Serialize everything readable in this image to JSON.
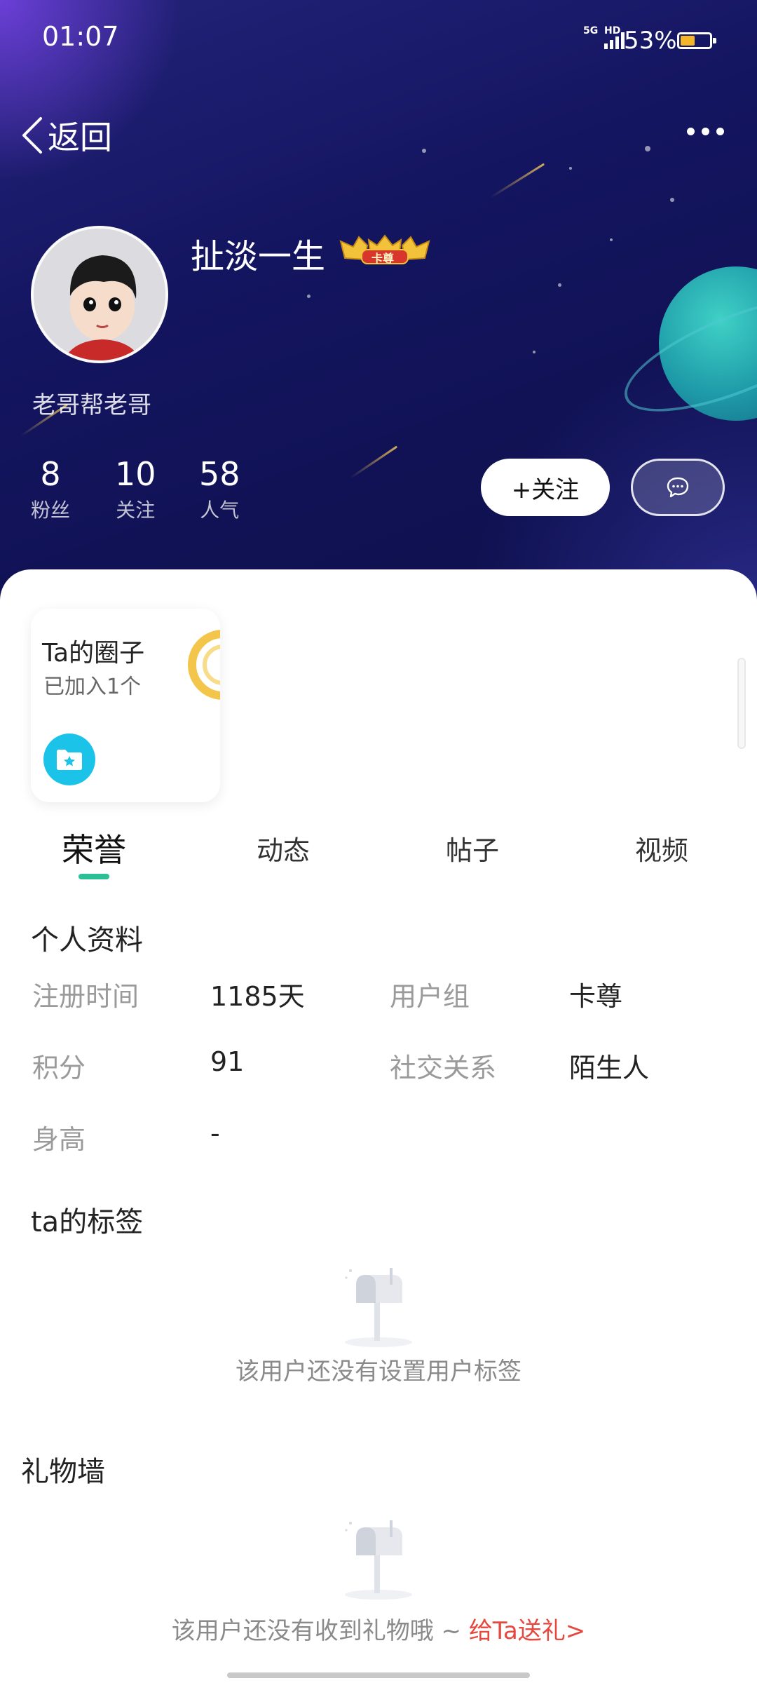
{
  "status_bar": {
    "time": "01:07",
    "network_top": "5G",
    "network_hd": "HD",
    "battery_percent": "53%",
    "battery_level": 0.53,
    "battery_color": "#f3b52a"
  },
  "nav": {
    "back_label": "返回"
  },
  "profile": {
    "username": "扯淡一生",
    "badge_text": "卡尊",
    "bio": "老哥帮老哥",
    "stats": [
      {
        "value": "8",
        "label": "粉丝"
      },
      {
        "value": "10",
        "label": "关注"
      },
      {
        "value": "58",
        "label": "人气"
      }
    ],
    "follow_label": "+关注"
  },
  "circle_card": {
    "title": "Ta的圈子",
    "subtitle": "已加入1个"
  },
  "tabs": [
    {
      "label": "荣誉",
      "active": true
    },
    {
      "label": "动态",
      "active": false
    },
    {
      "label": "帖子",
      "active": false
    },
    {
      "label": "视频",
      "active": false
    }
  ],
  "personal_info": {
    "title": "个人资料",
    "fields": [
      {
        "label": "注册时间",
        "value": "1185天"
      },
      {
        "label": "用户组",
        "value": "卡尊"
      },
      {
        "label": "积分",
        "value": "91"
      },
      {
        "label": "社交关系",
        "value": "陌生人"
      },
      {
        "label": "身高",
        "value": "-"
      }
    ]
  },
  "tags_section": {
    "title": "ta的标签",
    "empty_text": "该用户还没有设置用户标签"
  },
  "gift_wall": {
    "title": "礼物墙",
    "empty_text": "该用户还没有收到礼物哦 ~ ",
    "gift_link": "给Ta送礼>"
  },
  "colors": {
    "accent": "#2abf95",
    "link_red": "#e5483f",
    "folder_blue": "#1cc3e9"
  }
}
